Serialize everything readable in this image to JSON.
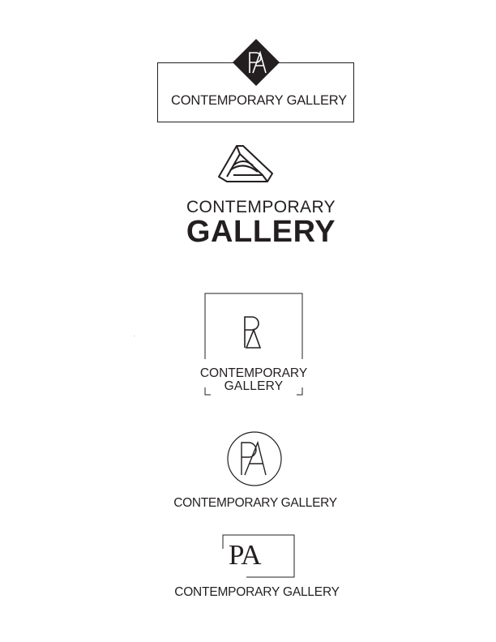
{
  "logos": [
    {
      "monogram": "PA",
      "name": "CONTEMPORARY GALLERY"
    },
    {
      "mark": "pa-geometric-triangle-icon",
      "name_line1": "CONTEMPORARY",
      "name_line2": "GALLERY"
    },
    {
      "monogram": "PA",
      "name_line1": "CONTEMPORARY",
      "name_line2": "GALLERY"
    },
    {
      "monogram": "PA",
      "name": "CONTEMPORARY GALLERY"
    },
    {
      "monogram": "PA",
      "name": "CONTEMPORARY GALLERY"
    }
  ],
  "colors": {
    "ink": "#231f20",
    "background": "#ffffff"
  }
}
